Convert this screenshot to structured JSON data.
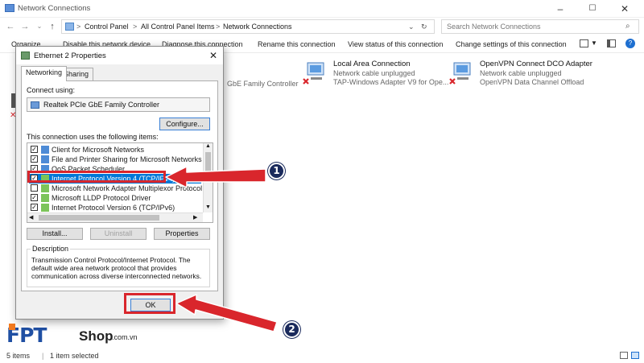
{
  "window": {
    "title": "Network Connections",
    "controls": {
      "minimize": "–",
      "maximize": "☐",
      "close": "✕"
    }
  },
  "address": {
    "segments": [
      "Control Panel",
      "All Control Panel Items",
      "Network Connections"
    ],
    "separator": ">",
    "search_placeholder": "Search Network Connections"
  },
  "commands": {
    "organize": "Organize",
    "disable": "Disable this network device",
    "diagnose": "Diagnose this connection",
    "rename": "Rename this connection",
    "view_status": "View status of this connection",
    "change_settings": "Change settings of this connection"
  },
  "adapters": [
    {
      "name": "",
      "status": "",
      "device": "GbE Family Controller"
    },
    {
      "name": "Local Area Connection",
      "status": "Network cable unplugged",
      "device": "TAP-Windows Adapter V9 for Ope..."
    },
    {
      "name": "OpenVPN Connect DCO Adapter",
      "status": "Network cable unplugged",
      "device": "OpenVPN Data Channel Offload"
    }
  ],
  "status_bar": {
    "items": "5 items",
    "selected": "1 item selected"
  },
  "dialog": {
    "title": "Ethernet 2 Properties",
    "tabs": [
      "Networking",
      "Sharing"
    ],
    "connect_using_label": "Connect using:",
    "adapter_name": "Realtek PCIe GbE Family Controller",
    "configure": "Configure...",
    "items_label": "This connection uses the following items:",
    "items": [
      {
        "label": "Client for Microsoft Networks",
        "checked": true
      },
      {
        "label": "File and Printer Sharing for Microsoft Networks",
        "checked": true
      },
      {
        "label": "QoS Packet Scheduler",
        "checked": true
      },
      {
        "label": "Internet Protocol Version 4 (TCP/IPv4)",
        "checked": true,
        "selected": true
      },
      {
        "label": "Microsoft Network Adapter Multiplexor Protocol",
        "checked": false
      },
      {
        "label": "Microsoft LLDP Protocol Driver",
        "checked": true
      },
      {
        "label": "Internet Protocol Version 6 (TCP/IPv6)",
        "checked": true
      }
    ],
    "install": "Install...",
    "uninstall": "Uninstall",
    "properties": "Properties",
    "description_label": "Description",
    "description": "Transmission Control Protocol/Internet Protocol. The default wide area network protocol that provides communication across diverse interconnected networks.",
    "ok": "OK"
  },
  "annotations": {
    "badge1": "1",
    "badge2": "2",
    "accent": "#d9262c"
  },
  "watermark": {
    "brand": "FPT",
    "shop": "Shop",
    "domain": ".com.vn"
  }
}
